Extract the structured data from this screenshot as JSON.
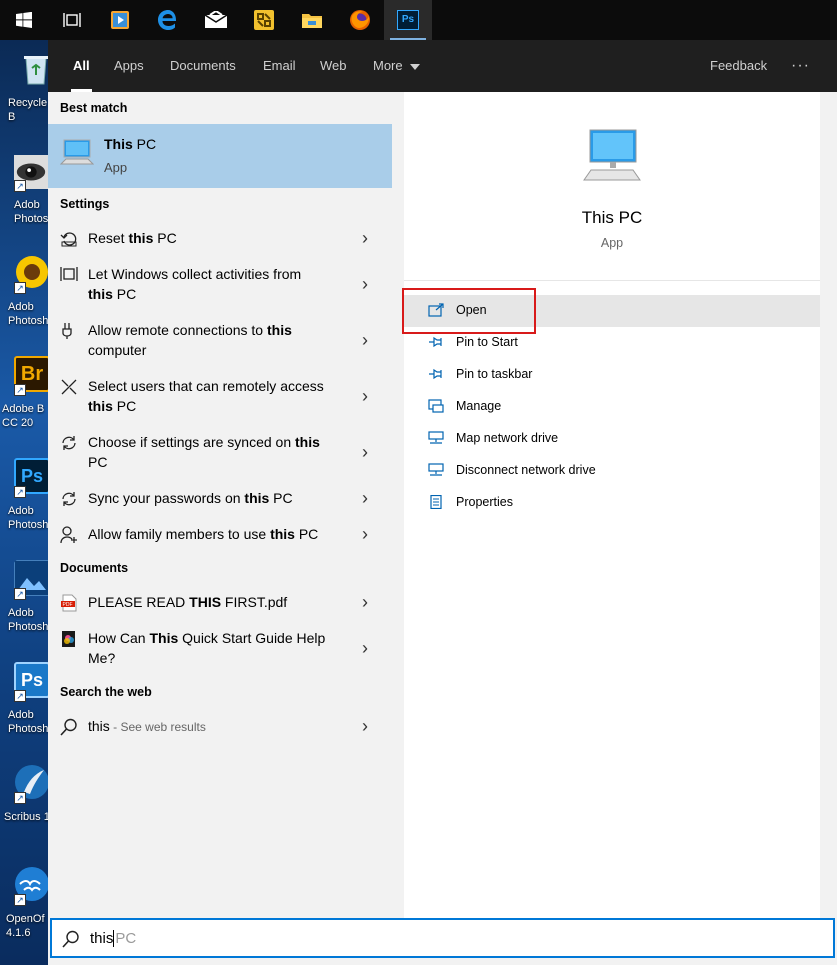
{
  "taskbar": {
    "buttons": [
      "start-icon",
      "task-view-icon",
      "media-player-icon",
      "edge-icon",
      "mail-icon",
      "tools-icon",
      "file-explorer-icon",
      "firefox-icon",
      "photoshop-icon"
    ],
    "photoshop_label": "Ps"
  },
  "desktop": {
    "icons": [
      {
        "label": "Recycle\nB"
      },
      {
        "label": "Adob\nPhotos"
      },
      {
        "label": "Adob\nPhotosh"
      },
      {
        "label": "Adobe B\nCC 20"
      },
      {
        "label": "Adob\nPhotosh"
      },
      {
        "label": "Adob\nPhotosh"
      },
      {
        "label": "Adob\nPhotosh"
      },
      {
        "label": "Scribus 1"
      },
      {
        "label": "OpenOf\n4.1.6"
      }
    ],
    "br_label": "Br",
    "ps_label": "Ps"
  },
  "filters": {
    "tabs": [
      "All",
      "Apps",
      "Documents",
      "Email",
      "Web",
      "More"
    ],
    "selected": "All",
    "feedback": "Feedback",
    "more_dots": "···"
  },
  "results": {
    "best_match_header": "Best match",
    "best_match": {
      "title_bold": "This",
      "title_rest": " PC",
      "subtitle": "App"
    },
    "settings_header": "Settings",
    "settings": [
      {
        "pre": "Reset ",
        "bold": "this",
        "post": " PC",
        "line2": ""
      },
      {
        "pre": "Let Windows collect activities from",
        "bold": "",
        "post": "",
        "line2_bold": "this",
        "line2": " PC"
      },
      {
        "pre": "Allow remote connections to ",
        "bold": "this",
        "post": "",
        "line2_bold": "",
        "line2": "computer"
      },
      {
        "pre": "Select users that can remotely access",
        "bold": "",
        "post": "",
        "line2_bold": "this",
        "line2": " PC"
      },
      {
        "pre": "Choose if settings are synced on ",
        "bold": "this",
        "post": "",
        "line2_bold": "",
        "line2": "PC"
      },
      {
        "pre": "Sync your passwords on ",
        "bold": "this",
        "post": " PC",
        "line2": ""
      },
      {
        "pre": "Allow family members to use ",
        "bold": "this",
        "post": " PC",
        "line2": ""
      }
    ],
    "documents_header": "Documents",
    "documents": [
      {
        "pre": "PLEASE READ ",
        "bold": "THIS",
        "post": " FIRST.pdf",
        "line2": ""
      },
      {
        "pre": "How Can ",
        "bold": "This",
        "post": " Quick Start Guide Help",
        "line2": "Me?"
      }
    ],
    "web_header": "Search the web",
    "web": {
      "query": "this",
      "hint": " - See web results"
    }
  },
  "detail": {
    "title": "This PC",
    "subtitle": "App",
    "actions": [
      "Open",
      "Pin to Start",
      "Pin to taskbar",
      "Manage",
      "Map network drive",
      "Disconnect network drive",
      "Properties"
    ]
  },
  "search": {
    "typed": "this",
    "suggestion": "PC"
  },
  "colors": {
    "accent": "#0078d7",
    "highlight": "#a9cde9",
    "annotation_box": "#d81a1a"
  }
}
